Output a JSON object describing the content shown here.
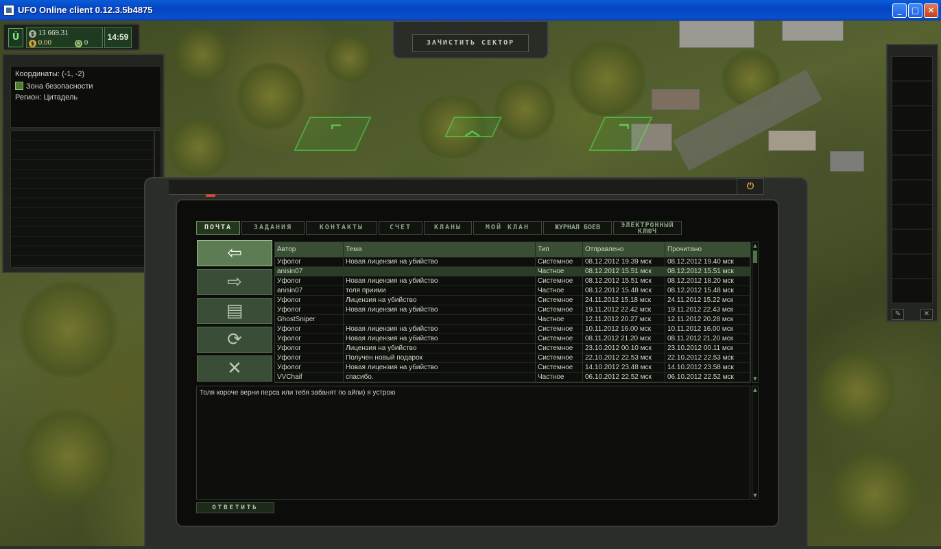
{
  "window": {
    "title": "UFO Online client 0.12.3.5b4875"
  },
  "resources": {
    "money": "13 669.31",
    "gold": "0.00",
    "tokens": "0",
    "time": "14:59"
  },
  "sector_button": "ЗАЧИСТИТЬ СЕКТОР",
  "location": {
    "coords_label": "Координаты:",
    "coords": "(-1, -2)",
    "zone": "Зона безопасности",
    "region_label": "Регион:",
    "region": "Цитадель"
  },
  "tabs": [
    {
      "label": "ПОЧТА",
      "active": true
    },
    {
      "label": "ЗАДАНИЯ"
    },
    {
      "label": "КОНТАКТЫ"
    },
    {
      "label": "СЧЕТ"
    },
    {
      "label": "КЛАНЫ"
    },
    {
      "label": "МОЙ КЛАН"
    },
    {
      "label": "ЖУРНАЛ БОЕВ"
    },
    {
      "label": "ЭЛЕКТРОННЫЙ КЛЮЧ"
    }
  ],
  "side_buttons": [
    {
      "icon": "inbox-icon",
      "glyph": "⇦"
    },
    {
      "icon": "outbox-icon",
      "glyph": "⇨"
    },
    {
      "icon": "document-icon",
      "glyph": "▤"
    },
    {
      "icon": "refresh-icon",
      "glyph": "⟳"
    },
    {
      "icon": "delete-icon",
      "glyph": "✕"
    }
  ],
  "mail": {
    "columns": [
      "Автор",
      "Тема",
      "Тип",
      "Отправлено",
      "Прочитано"
    ],
    "rows": [
      [
        "Уфолог",
        "Новая лицензия на убийство",
        "Системное",
        "08.12.2012 19.39 мск",
        "08.12.2012 19.40 мск"
      ],
      [
        "anisin07",
        "",
        "Частное",
        "08.12.2012 15.51 мск",
        "08.12.2012 15.51 мск"
      ],
      [
        "Уфолог",
        "Новая лицензия на убийство",
        "Системное",
        "08.12.2012 15.51 мск",
        "08.12.2012 18.20 мск"
      ],
      [
        "anisin07",
        "толя приими",
        "Частное",
        "08.12.2012 15.48 мск",
        "08.12.2012 15.48 мск"
      ],
      [
        "Уфолог",
        "Лицензия на убийство",
        "Системное",
        "24.11.2012 15.18 мск",
        "24.11.2012 15.22 мск"
      ],
      [
        "Уфолог",
        "Новая лицензия на убийство",
        "Системное",
        "19.11.2012 22.42 мск",
        "19.11.2012 22.43 мск"
      ],
      [
        "GhostSniper",
        "",
        "Частное",
        "12.11.2012 20.27 мск",
        "12.11.2012 20.28 мск"
      ],
      [
        "Уфолог",
        "Новая лицензия на убийство",
        "Системное",
        "10.11.2012 16.00 мск",
        "10.11.2012 16.00 мск"
      ],
      [
        "Уфолог",
        "Новая лицензия на убийство",
        "Системное",
        "08.11.2012 21.20 мск",
        "08.11.2012 21.20 мск"
      ],
      [
        "Уфолог",
        "Лицензия на убийство",
        "Системное",
        "23.10.2012 00.10 мск",
        "23.10.2012 00.11 мск"
      ],
      [
        "Уфолог",
        "Получен новый подарок",
        "Системное",
        "22.10.2012 22.53 мск",
        "22.10.2012 22.53 мск"
      ],
      [
        "Уфолог",
        "Новая лицензия на убийство",
        "Системное",
        "14.10.2012 23.48 мск",
        "14.10.2012 23.58 мск"
      ],
      [
        "VVChaif",
        "спасибо.",
        "Частное",
        "06.10.2012 22.52 мск",
        "06.10.2012 22.52 мск"
      ]
    ],
    "selected_row": 1
  },
  "message_body": "Толя короче верни перса или тебя забанят по айпи) я устрою",
  "reply_button": "ОТВЕТИТЬ",
  "colors": {
    "accent": "#5d7c54",
    "header": "#3a4e35",
    "text": "#cfd8c7"
  }
}
